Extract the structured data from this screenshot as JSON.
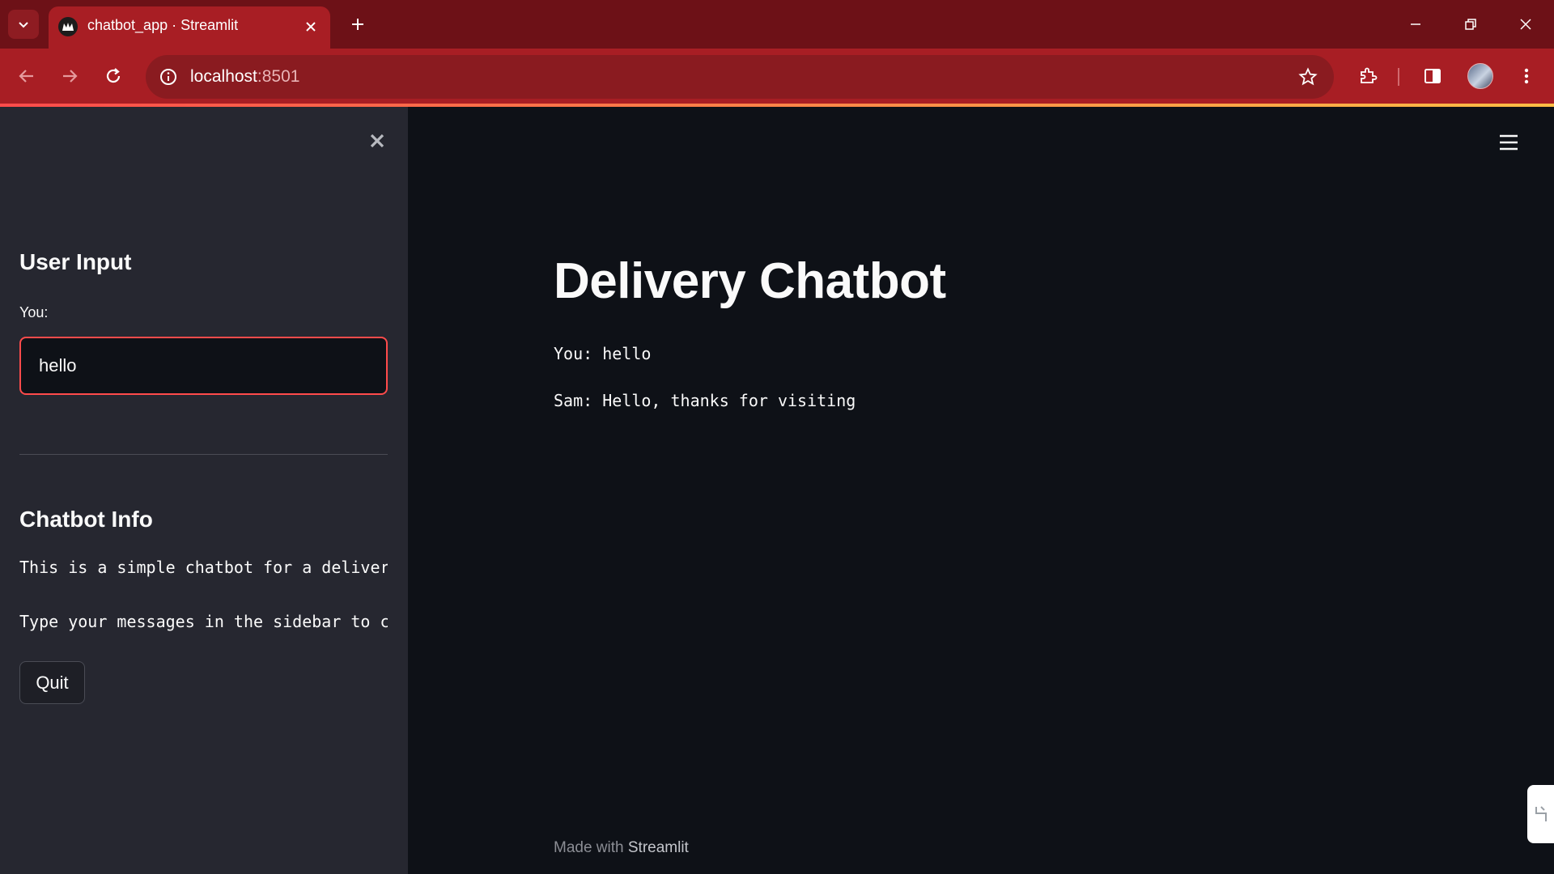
{
  "browser": {
    "tab_title": "chatbot_app · Streamlit",
    "url_host": "localhost",
    "url_port": ":8501"
  },
  "sidebar": {
    "user_input_heading": "User Input",
    "input_label": "You:",
    "input_value": "hello",
    "info_heading": "Chatbot Info",
    "info_line_1": "This is a simple chatbot for a delivery",
    "info_line_2": "Type your messages in the sidebar to chat",
    "quit_label": "Quit"
  },
  "main": {
    "title": "Delivery Chatbot",
    "messages": [
      "You: hello",
      "Sam: Hello, thanks for visiting"
    ],
    "footer_prefix": "Made with ",
    "footer_brand": "Streamlit"
  },
  "colors": {
    "browser_frame": "#a81e24",
    "sidebar_bg": "#262730",
    "main_bg": "#0e1117",
    "accent": "#ff4b4b"
  }
}
